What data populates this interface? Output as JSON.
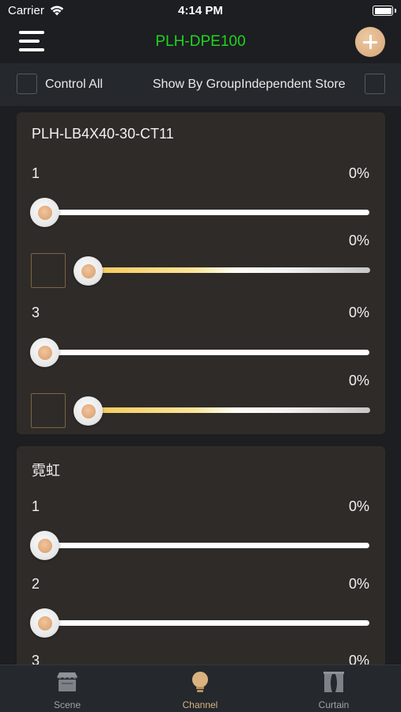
{
  "status_bar": {
    "carrier": "Carrier",
    "time": "4:14 PM"
  },
  "header": {
    "title": "PLH-DPE100",
    "title_color": "#1fd41f",
    "menu_icon": "hamburger-menu-icon",
    "add_icon": "plus-circle-icon"
  },
  "toolbar": {
    "control_all": {
      "label": "Control All",
      "checked": false
    },
    "show_by_group": {
      "label": "Show By Group"
    },
    "independent_store": {
      "label": "Independent Store",
      "checked": false
    }
  },
  "cards": [
    {
      "title": "PLH-LB4X40-30-CT11",
      "channels": [
        {
          "name": "1",
          "percent": "0%",
          "type": "dimmer",
          "level": 0
        },
        {
          "name": "",
          "percent": "0%",
          "type": "color-temperature",
          "level": 0
        },
        {
          "name": "3",
          "percent": "0%",
          "type": "dimmer",
          "level": 0
        },
        {
          "name": "",
          "percent": "0%",
          "type": "color-temperature",
          "level": 0
        }
      ]
    },
    {
      "title": "霓虹",
      "channels": [
        {
          "name": "1",
          "percent": "0%",
          "type": "dimmer",
          "level": 0
        },
        {
          "name": "2",
          "percent": "0%",
          "type": "dimmer",
          "level": 0
        },
        {
          "name": "3",
          "percent": "0%",
          "type": "dimmer",
          "level": 0
        }
      ]
    }
  ],
  "tab_bar": {
    "tabs": [
      {
        "label": "Scene",
        "icon": "scene-store-icon",
        "active": false
      },
      {
        "label": "Channel",
        "icon": "lightbulb-icon",
        "active": true
      },
      {
        "label": "Curtain",
        "icon": "curtain-icon",
        "active": false
      }
    ],
    "active_color": "#d9b27f",
    "inactive_color": "#9ea3aa"
  },
  "colors": {
    "background": "#1c1e21",
    "card": "#2f2b28",
    "knob_center": "#d69c6c"
  }
}
